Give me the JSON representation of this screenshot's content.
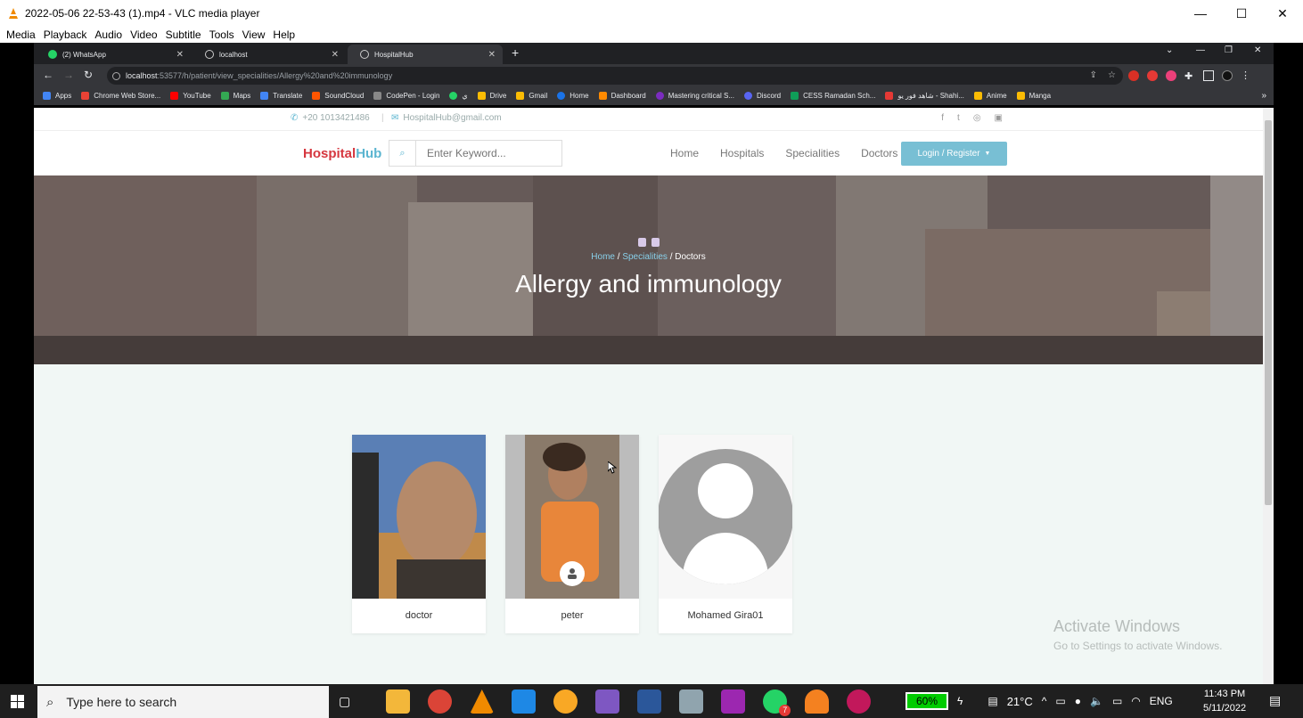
{
  "vlc": {
    "title": "2022-05-06 22-53-43 (1).mp4 - VLC media player",
    "menu": [
      "Media",
      "Playback",
      "Audio",
      "Video",
      "Subtitle",
      "Tools",
      "View",
      "Help"
    ]
  },
  "chrome": {
    "tabs": [
      {
        "label": "(2) WhatsApp",
        "icon": "whatsapp-icon"
      },
      {
        "label": "localhost",
        "icon": "globe-icon"
      },
      {
        "label": "HospitalHub",
        "icon": "globe-icon"
      }
    ],
    "url_host": "localhost",
    "url_path": ":53577/h/patient/view_specialities/Allergy%20and%20immunology",
    "bookmarks": [
      {
        "label": "Apps",
        "color": "#4285f4"
      },
      {
        "label": "Chrome Web Store...",
        "color": "#e94235"
      },
      {
        "label": "YouTube",
        "color": "#ff0000"
      },
      {
        "label": "Maps",
        "color": "#34a853"
      },
      {
        "label": "Translate",
        "color": "#4285f4"
      },
      {
        "label": "SoundCloud",
        "color": "#ff5500"
      },
      {
        "label": "CodePen - Login",
        "color": "#888888"
      },
      {
        "label": "ي",
        "color": "#25d366"
      },
      {
        "label": "Drive",
        "color": "#fbbc04"
      },
      {
        "label": "Gmail",
        "color": "#fbbc04"
      },
      {
        "label": "Home",
        "color": "#1a73e8"
      },
      {
        "label": "Dashboard",
        "color": "#ff8a00"
      },
      {
        "label": "Mastering critical S...",
        "color": "#7b2cbf"
      },
      {
        "label": "Discord",
        "color": "#5865f2"
      },
      {
        "label": "CESS Ramadan Sch...",
        "color": "#0f9d58"
      },
      {
        "label": "شاهد فور يو - Shahi...",
        "color": "#e53935"
      },
      {
        "label": "Anime",
        "color": "#fbbc04"
      },
      {
        "label": "Manga",
        "color": "#fbbc04"
      }
    ]
  },
  "site": {
    "phone": "+20 1013421486",
    "email": "HospitalHub@gmail.com",
    "brand_part1": "Hospital",
    "brand_part2": "Hub",
    "search_placeholder": "Enter Keyword...",
    "nav": [
      "Home",
      "Hospitals",
      "Specialities",
      "Doctors"
    ],
    "login_label": "Login / Register",
    "breadcrumb": {
      "home": "Home",
      "specialities": "Specialities",
      "current": "Doctors"
    },
    "hero_title": "Allergy and immunology",
    "doctors": [
      {
        "name": "doctor"
      },
      {
        "name": "peter"
      },
      {
        "name": "Mohamed Gira01"
      }
    ],
    "watermark_1": "Activate Windows",
    "watermark_2": "Go to Settings to activate Windows."
  },
  "taskbar": {
    "search_placeholder": "Type here to search",
    "battery": "60%",
    "temperature": "21°C",
    "language": "ENG",
    "time": "11:43 PM",
    "date": "5/11/2022",
    "whatsapp_badge": "7"
  }
}
